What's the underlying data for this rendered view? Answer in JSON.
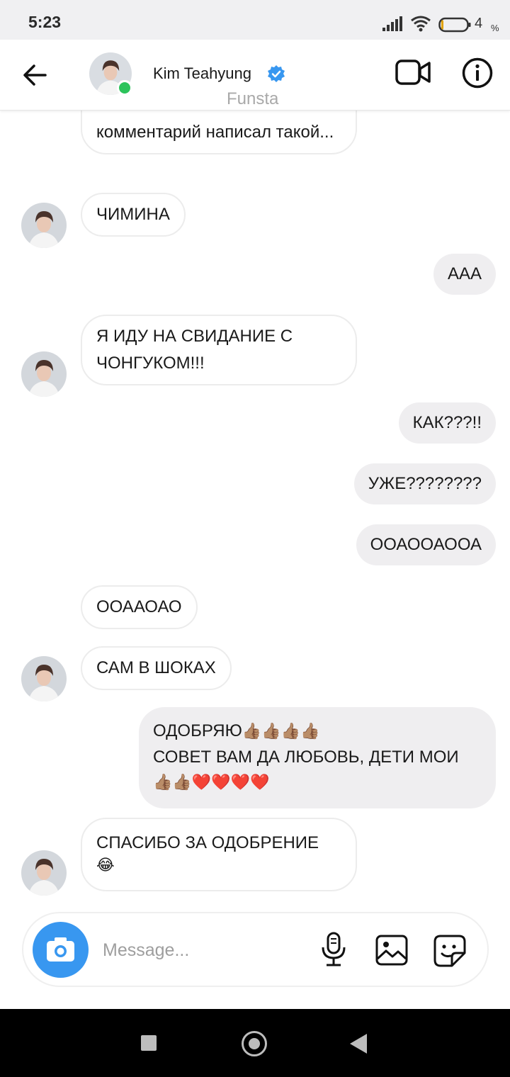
{
  "status_bar": {
    "time": "5:23",
    "battery_level": "4",
    "battery_unit": "%"
  },
  "header": {
    "contact_name": "Kim Teahyung",
    "watermark": "Funsta",
    "avatar_icon": "avatar-photo-icon",
    "verified_color": "#3897f0",
    "online_color": "#2cc35b"
  },
  "messages": [
    {
      "id": "m0",
      "side": "in",
      "text": "комментарий написал такой..."
    },
    {
      "id": "m1",
      "side": "in",
      "text": "ЧИМИНА"
    },
    {
      "id": "m2",
      "side": "out",
      "text": "ААА"
    },
    {
      "id": "m3",
      "side": "in",
      "text": "Я ИДУ НА СВИДАНИЕ С ЧОНГУКОМ!!!"
    },
    {
      "id": "m4",
      "side": "out",
      "text": "КАК???!!"
    },
    {
      "id": "m5",
      "side": "out",
      "text": "УЖЕ????????"
    },
    {
      "id": "m6",
      "side": "out",
      "text": "ООАООАООА"
    },
    {
      "id": "m7",
      "side": "in",
      "text": "ООААОАО"
    },
    {
      "id": "m8",
      "side": "in",
      "text": "САМ В ШОКАХ"
    },
    {
      "id": "m9",
      "side": "out",
      "line1": "ОДОБРЯЮ",
      "emoji1": "👍🏽👍🏽👍🏽👍🏽",
      "line2": "СОВЕТ ВАМ ДА ЛЮБОВЬ, ДЕТИ МОИ",
      "emoji2": "👍🏽👍🏽❤️❤️❤️❤️"
    },
    {
      "id": "m10",
      "side": "in",
      "text": "СПАСИБО ЗА ОДОБРЕНИЕ",
      "emoji": "😂"
    }
  ],
  "composer": {
    "placeholder": "Message..."
  },
  "colors": {
    "accent": "#3897f0",
    "incoming_border": "#ececec",
    "outgoing_bg": "#efeef0"
  }
}
